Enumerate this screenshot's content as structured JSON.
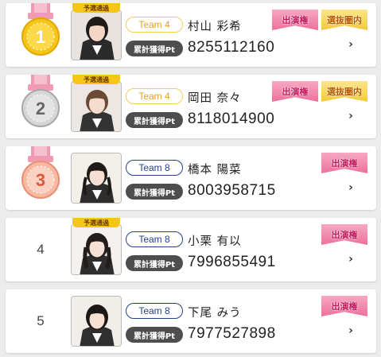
{
  "rows": [
    {
      "rank_display": "1",
      "medal": "gold",
      "yosen_badge": "予選通過",
      "team": "Team 4",
      "team_style": "yellow",
      "name": "村山 彩希",
      "points_label": "累計獲得Pt",
      "points": "8255112160",
      "tags": [
        "出演権",
        "選抜圏内"
      ],
      "chevron": "›"
    },
    {
      "rank_display": "2",
      "medal": "silver",
      "yosen_badge": "予選通過",
      "team": "Team 4",
      "team_style": "yellow",
      "name": "岡田 奈々",
      "points_label": "累計獲得Pt",
      "points": "8118014900",
      "tags": [
        "出演権",
        "選抜圏内"
      ],
      "chevron": "›"
    },
    {
      "rank_display": "3",
      "medal": "bronze",
      "yosen_badge": "",
      "team": "Team 8",
      "team_style": "blue",
      "name": "橋本 陽菜",
      "points_label": "累計獲得Pt",
      "points": "8003958715",
      "tags": [
        "出演権"
      ],
      "chevron": "›"
    },
    {
      "rank_display": "4",
      "medal": "",
      "yosen_badge": "予選通過",
      "team": "Team 8",
      "team_style": "blue",
      "name": "小栗 有以",
      "points_label": "累計獲得Pt",
      "points": "7996855491",
      "tags": [
        "出演権"
      ],
      "chevron": "›"
    },
    {
      "rank_display": "5",
      "medal": "",
      "yosen_badge": "",
      "team": "Team 8",
      "team_style": "blue",
      "name": "下尾 みう",
      "points_label": "累計獲得Pt",
      "points": "7977527898",
      "tags": [
        "出演権"
      ],
      "chevron": "›"
    }
  ],
  "colors": {
    "gold": "#f5c518",
    "silver": "#c9c9c9",
    "bronze": "#f2a48a",
    "ribbon": "#f29ab3",
    "team_yellow": "#e6a31b",
    "team_blue": "#26418b",
    "tag_pink": "#ee6f9c",
    "tag_gold": "#f3c93a"
  },
  "icons": {
    "chevron": "chevron-right-icon",
    "medal": "medal-icon"
  }
}
